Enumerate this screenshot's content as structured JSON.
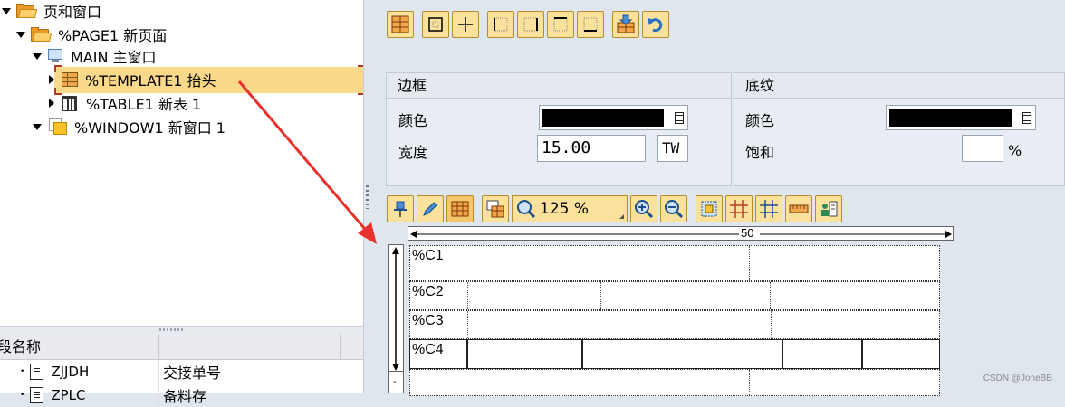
{
  "tree": {
    "root_label": "页和窗口",
    "page1_label": "%PAGE1 新页面",
    "main_label": "MAIN 主窗口",
    "template_label": "%TEMPLATE1 抬头",
    "table_label": "%TABLE1 新表 1",
    "window_label": "%WINDOW1 新窗口 1"
  },
  "field_list": {
    "column_header": "段名称",
    "rows": [
      {
        "name": "ZJJDH",
        "desc": "交接单号"
      },
      {
        "name": "ZPLC",
        "desc": "备料存"
      }
    ]
  },
  "border_group": {
    "title": "边框",
    "color_label": "颜色",
    "width_label": "宽度",
    "width_value": "15.00",
    "unit": "TW"
  },
  "shading_group": {
    "title": "底纹",
    "color_label": "颜色",
    "saturation_label": "饱和",
    "saturation_value": "",
    "percent_sign": "%"
  },
  "canvas": {
    "zoom": "125 %",
    "ruler_value": "50",
    "rows": [
      "%C1",
      "%C2",
      "%C3",
      "%C4"
    ]
  },
  "colors": {
    "accent": "#fbe29c",
    "selection": "#fbd98a",
    "arrow": "#e8312c"
  },
  "watermark": "CSDN @JoneBB"
}
